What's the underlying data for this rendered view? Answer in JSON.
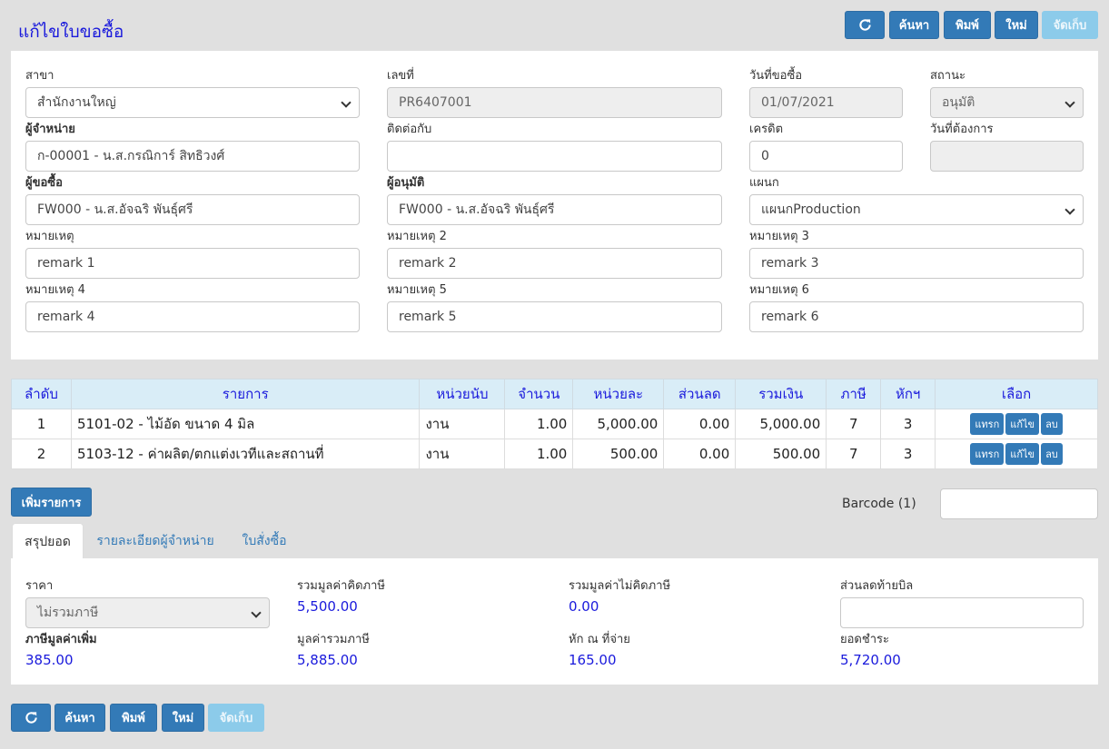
{
  "page_title": "แก้ไขใบขอซื้อ",
  "toolbar": {
    "search": "ค้นหา",
    "print": "พิมพ์",
    "new": "ใหม่",
    "save": "จัดเก็บ"
  },
  "form": {
    "branch_label": "สาขา",
    "branch_value": "สำนักงานใหญ่",
    "docno_label": "เลขที่",
    "docno_value": "PR6407001",
    "reqdate_label": "วันที่ขอซื้อ",
    "reqdate_value": "01/07/2021",
    "status_label": "สถานะ",
    "status_value": "อนุมัติ",
    "vendor_label": "ผู้จำหน่าย",
    "vendor_value": "ก-00001 - น.ส.กรณิการ์ สิทธิวงศ์",
    "contact_label": "ติดต่อกับ",
    "contact_value": "",
    "credit_label": "เครดิต",
    "credit_value": "0",
    "needdate_label": "วันที่ต้องการ",
    "needdate_value": "",
    "requester_label": "ผู้ขอซื้อ",
    "requester_value": "FW000 - น.ส.อัจฉริ พันธุ์ศรี",
    "approver_label": "ผู้อนุมัติ",
    "approver_value": "FW000 - น.ส.อัจฉริ พันธุ์ศรี",
    "dept_label": "แผนก",
    "dept_value": "แผนกProduction",
    "remark1_label": "หมายเหตุ",
    "remark1_value": "remark 1",
    "remark2_label": "หมายเหตุ 2",
    "remark2_value": "remark 2",
    "remark3_label": "หมายเหตุ 3",
    "remark3_value": "remark 3",
    "remark4_label": "หมายเหตุ 4",
    "remark4_value": "remark 4",
    "remark5_label": "หมายเหตุ 5",
    "remark5_value": "remark 5",
    "remark6_label": "หมายเหตุ 6",
    "remark6_value": "remark 6"
  },
  "table": {
    "headers": [
      "ลำดับ",
      "รายการ",
      "หน่วยนับ",
      "จำนวน",
      "หน่วยละ",
      "ส่วนลด",
      "รวมเงิน",
      "ภาษี",
      "หักฯ",
      "เลือก"
    ],
    "row_buttons": {
      "insert": "แทรก",
      "edit": "แก้ไข",
      "delete": "ลบ"
    },
    "rows": [
      {
        "no": "1",
        "item": "5101-02 - ไม้อัด ขนาด 4 มิล",
        "unit": "งาน",
        "qty": "1.00",
        "price": "5,000.00",
        "discount": "0.00",
        "total": "5,000.00",
        "tax": "7",
        "wht": "3"
      },
      {
        "no": "2",
        "item": "5103-12 - ค่าผลิต/ตกแต่งเวทีและสถานที่",
        "unit": "งาน",
        "qty": "1.00",
        "price": "500.00",
        "discount": "0.00",
        "total": "500.00",
        "tax": "7",
        "wht": "3"
      }
    ]
  },
  "add_item": "เพิ่มรายการ",
  "barcode_label": "Barcode (1)",
  "tabs": {
    "summary": "สรุปยอด",
    "vendor_detail": "รายละเอียดผู้จำหน่าย",
    "po": "ใบสั่งซื้อ"
  },
  "summary": {
    "price_label": "ราคา",
    "price_value": "ไม่รวมภาษี",
    "taxable_label": "รวมมูลค่าคิดภาษี",
    "taxable_value": "5,500.00",
    "nontax_label": "รวมมูลค่าไม่คิดภาษี",
    "nontax_value": "0.00",
    "billdisc_label": "ส่วนลดท้ายบิล",
    "billdisc_value": "",
    "vat_label": "ภาษีมูลค่าเพิ่ม",
    "vat_value": "385.00",
    "incl_label": "มูลค่ารวมภาษี",
    "incl_value": "5,885.00",
    "wht_label": "หัก ณ ที่จ่าย",
    "wht_value": "165.00",
    "net_label": "ยอดชำระ",
    "net_value": "5,720.00"
  }
}
